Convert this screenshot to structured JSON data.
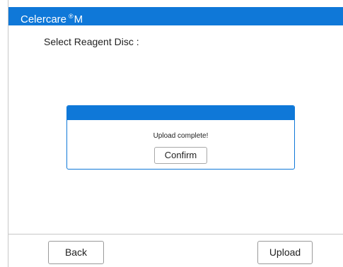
{
  "app": {
    "title_main": "Celercare",
    "title_reg": "®",
    "title_suffix": "M"
  },
  "main": {
    "prompt": "Select Reagent Disc :"
  },
  "dialog": {
    "message": "Upload complete!",
    "confirm_label": "Confirm"
  },
  "footer": {
    "back_label": "Back",
    "upload_label": "Upload"
  },
  "colors": {
    "accent": "#0f78d8"
  }
}
